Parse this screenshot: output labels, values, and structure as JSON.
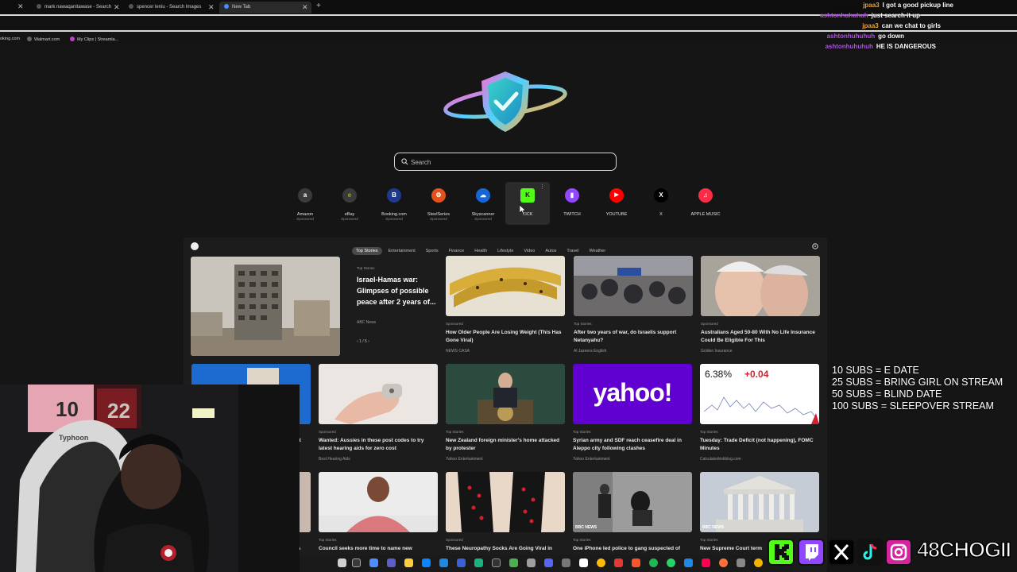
{
  "tabs": [
    {
      "label": "mark nawaqanitawase - Search",
      "active": false
    },
    {
      "label": "spencer leniu - Search Images",
      "active": false
    },
    {
      "label": "New Tab",
      "active": true
    }
  ],
  "bookmarks": [
    "oking.com",
    "Walmart.com",
    "My Clips | Streamla..."
  ],
  "chat": [
    {
      "user": "jpaa3",
      "user_color": "#f0a637",
      "message": "I got a good pickup line"
    },
    {
      "user": "ashtonhuhuhuh",
      "user_color": "#b455e6",
      "message": "just search it up"
    },
    {
      "user": "jpaa3",
      "user_color": "#f0a637",
      "message": "can we chat to girls"
    },
    {
      "user": "ashtonhuhuhuh",
      "user_color": "#b455e6",
      "message": "go down"
    },
    {
      "user": "ashtonhuhuhuh",
      "user_color": "#b455e6",
      "message": "HE IS DANGEROUS"
    }
  ],
  "search": {
    "placeholder": "Search"
  },
  "shortcuts": [
    {
      "label": "Amazon",
      "sponsored": "Sponsored",
      "icon": "amazon-icon",
      "color": "#3a3a3a",
      "glyph": "a"
    },
    {
      "label": "eBay",
      "sponsored": "Sponsored",
      "icon": "ebay-icon",
      "color": "#3a3a3a",
      "glyph": "e"
    },
    {
      "label": "Booking.com",
      "sponsored": "Sponsored",
      "icon": "booking-icon",
      "color": "#1f3a8a",
      "glyph": "B"
    },
    {
      "label": "SteelSeries",
      "sponsored": "Sponsored",
      "icon": "steelseries-icon",
      "color": "#e2531c",
      "glyph": "⚙"
    },
    {
      "label": "Skyscanner",
      "sponsored": "Sponsored",
      "icon": "skyscanner-icon",
      "color": "#1766d6",
      "glyph": "☁"
    },
    {
      "label": "KICK",
      "sponsored": "",
      "icon": "kick-icon",
      "color": "#53fc18",
      "glyph": "K"
    },
    {
      "label": "TWITCH",
      "sponsored": "",
      "icon": "twitch-icon",
      "color": "#9146ff",
      "glyph": "▮"
    },
    {
      "label": "YOUTUBE",
      "sponsored": "",
      "icon": "youtube-icon",
      "color": "#ff0000",
      "glyph": "▶"
    },
    {
      "label": "X",
      "sponsored": "",
      "icon": "x-icon",
      "color": "#000000",
      "glyph": "X"
    },
    {
      "label": "APPLE MUSIC",
      "sponsored": "",
      "icon": "apple-music-icon",
      "color": "#fa2d48",
      "glyph": "♫"
    }
  ],
  "feed": {
    "categories": [
      "Top Stories",
      "Entertainment",
      "Sports",
      "Finance",
      "Health",
      "Lifestyle",
      "Video",
      "Autos",
      "Travel",
      "Weather"
    ],
    "hero": {
      "kicker": "Top Stories",
      "title": "Israel-Hamas war: Glimpses of possible peace after 2 years of...",
      "source": "ABC News",
      "pager": "1 / 5"
    },
    "row1": [
      {
        "kicker": "Sponsored",
        "title": "How Older People Are Losing Weight (This Has Gone Viral)",
        "source": "NEWS CASA"
      },
      {
        "kicker": "Top Stories",
        "title": "After two years of war, do Israelis support Netanyahu?",
        "source": "Al Jazeera English"
      },
      {
        "kicker": "Sponsored",
        "title": "Australians Aged 50-80 With No Life Insurance Could Be Eligible For This",
        "source": "Golden Insurance"
      }
    ],
    "row2": [
      {
        "kicker": "Sponsored",
        "title": "Wanted: Aussies in these post codes to try latest hearing aids for zero cost",
        "source": "Best Hearing Aids"
      },
      {
        "kicker": "Top Stories",
        "title": "New Zealand foreign minister's home attacked by protester",
        "source": "Yahoo Entertainment"
      },
      {
        "kicker": "Top Stories",
        "title": "Syrian army and SDF reach ceasefire deal in Aleppo city following clashes",
        "source": "Yahoo Entertainment"
      },
      {
        "kicker": "Top Stories",
        "title": "Tuesday: Trade Deficit (not happening), FOMC Minutes",
        "source": "Calculatedriskblog.com"
      }
    ],
    "row2_partial": {
      "title": "st"
    },
    "row3": [
      {
        "kicker": "Top Stories",
        "title": "Council seeks more time to name new"
      },
      {
        "kicker": "Sponsored",
        "title": "These Neuropathy Socks Are Going Viral in"
      },
      {
        "kicker": "Top Stories",
        "title": "One iPhone led police to gang suspected of"
      },
      {
        "kicker": "Top Stories",
        "title": "New Supreme Court term"
      }
    ],
    "row3_partial": {
      "title": "is"
    },
    "yahoo_logo": "yahoo!",
    "chart_tile": {
      "value": "6.38%",
      "change": "+0.04"
    },
    "bbc": "BBC NEWS"
  },
  "subs_goals": [
    "10 SUBS = E DATE",
    "25 SUBS = BRING GIRL ON STREAM",
    "50 SUBS = BLIND DATE",
    "100 SUBS = SLEEPOVER STREAM"
  ],
  "webcam": {
    "chair_brand": "Typhoon",
    "jersey_numbers": [
      "10",
      "22"
    ]
  },
  "socials": {
    "handle": "48CHOGII"
  }
}
